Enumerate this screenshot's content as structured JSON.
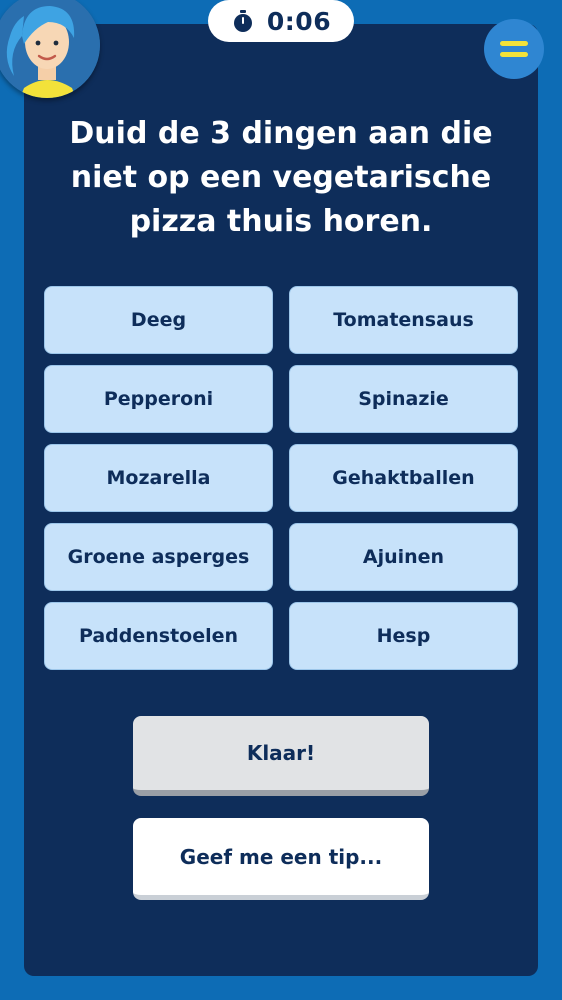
{
  "timer": {
    "icon": "stopwatch-icon",
    "time": "0:06"
  },
  "menu": {
    "icon": "hamburger-menu-icon",
    "accent_color": "#f3e23a"
  },
  "avatar": {
    "icon": "character-avatar"
  },
  "question": "Duid de 3 dingen aan die niet op een vegetarische pizza thuis horen.",
  "options": [
    {
      "label": "Deeg"
    },
    {
      "label": "Tomatensaus"
    },
    {
      "label": "Pepperoni"
    },
    {
      "label": "Spinazie"
    },
    {
      "label": "Mozarella"
    },
    {
      "label": "Gehaktballen"
    },
    {
      "label": "Groene asperges"
    },
    {
      "label": "Ajuinen"
    },
    {
      "label": "Paddenstoelen"
    },
    {
      "label": "Hesp"
    }
  ],
  "actions": {
    "done_label": "Klaar!",
    "tip_label": "Geef me een tip..."
  },
  "colors": {
    "background": "#0d6cb5",
    "panel": "#0e2d5a",
    "option": "#c7e2fa",
    "text_dark": "#0e2d5a"
  }
}
